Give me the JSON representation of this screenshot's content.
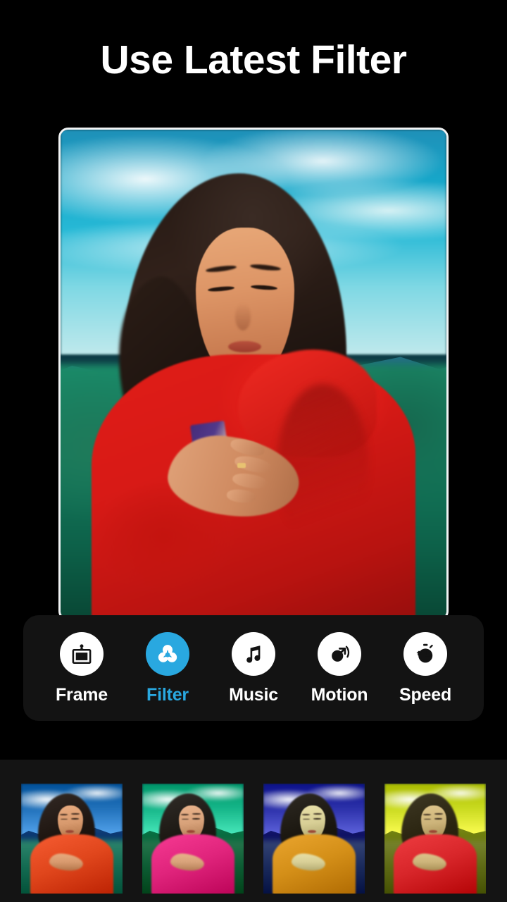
{
  "headline": "Use Latest Filter",
  "photo": {
    "alt_description": "Woman with dark wavy hair wearing a red hoodie, eyes closed, mountains and sky background"
  },
  "toolbar": {
    "items": [
      {
        "label": "Frame",
        "icon": "picture-frame-icon",
        "active": false
      },
      {
        "label": "Filter",
        "icon": "color-filter-icon",
        "active": true
      },
      {
        "label": "Music",
        "icon": "music-note-icon",
        "active": false
      },
      {
        "label": "Motion",
        "icon": "motion-arrow-icon",
        "active": false
      },
      {
        "label": "Speed",
        "icon": "stopwatch-icon",
        "active": false
      }
    ],
    "active_label": "Filter",
    "accent_color": "#29a8e0",
    "inactive_color": "#ffffff",
    "panel_color": "#131313"
  },
  "filter_strip": {
    "background_color": "#141414",
    "thumbnails": [
      {
        "name": "filter-thumbnail-1",
        "selected": false,
        "sky": "#1f6fb8",
        "mountain": "#15457f",
        "ground": "#136b52",
        "jacket": "#e0461c",
        "skin": "#d89a6e",
        "hair": "#1e1510"
      },
      {
        "name": "filter-thumbnail-2",
        "selected": false,
        "sky": "#14b487",
        "mountain": "#0e7a4e",
        "ground": "#0c5c33",
        "jacket": "#e0247c",
        "skin": "#d8a27a",
        "hair": "#1c1813"
      },
      {
        "name": "filter-thumbnail-3",
        "selected": false,
        "sky": "#2a2fa8",
        "mountain": "#1c1f72",
        "ground": "#1a2a5c",
        "jacket": "#d48f18",
        "skin": "#d8cf96",
        "hair": "#1a160f"
      },
      {
        "name": "filter-thumbnail-4",
        "selected": false,
        "sky": "#c8d91e",
        "mountain": "#7d8c1c",
        "ground": "#5e6a14",
        "jacket": "#d8262a",
        "skin": "#cdb47a",
        "hair": "#2a2410"
      }
    ]
  },
  "colors": {
    "page_background": "#000000",
    "headline_color": "#ffffff",
    "photo_border": "#f2f4f5"
  }
}
